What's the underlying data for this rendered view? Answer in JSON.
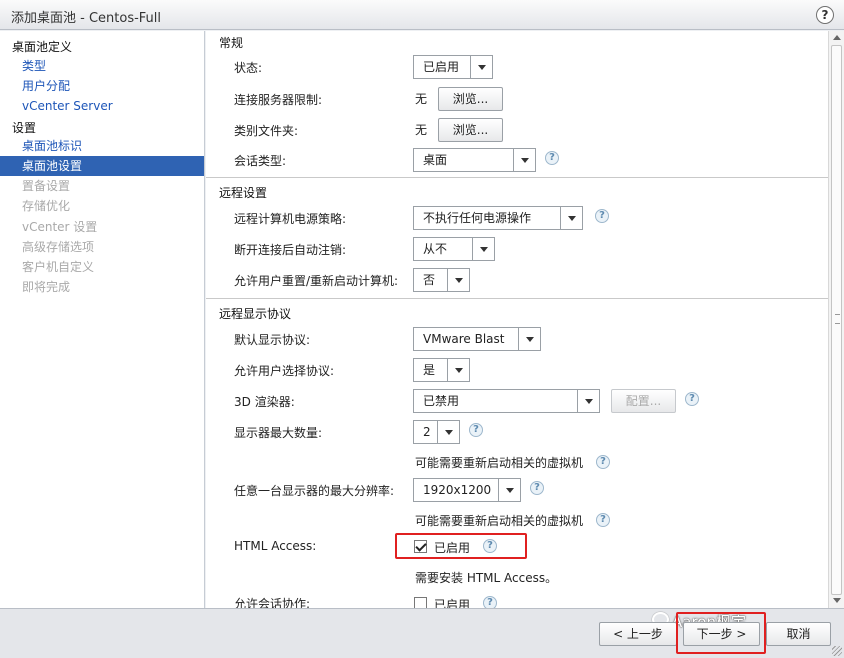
{
  "window": {
    "title": "添加桌面池 - Centos-Full",
    "help_glyph": "?"
  },
  "sidebar": {
    "group1": "桌面池定义",
    "group1_items": [
      "类型",
      "用户分配",
      "vCenter Server"
    ],
    "group2": "设置",
    "group2_items": [
      "桌面池标识",
      "桌面池设置",
      "置备设置",
      "存储优化",
      "vCenter 设置",
      "高级存储选项",
      "客户机自定义",
      "即将完成"
    ],
    "active_item": "桌面池设置"
  },
  "general": {
    "title": "常规",
    "status_label": "状态:",
    "status_value": "已启用",
    "conn_server_label": "连接服务器限制:",
    "conn_server_value": "无",
    "browse_label": "浏览...",
    "category_folder_label": "类别文件夹:",
    "category_folder_value": "无",
    "session_type_label": "会话类型:",
    "session_type_value": "桌面"
  },
  "remote": {
    "title": "远程设置",
    "power_policy_label": "远程计算机电源策略:",
    "power_policy_value": "不执行任何电源操作",
    "auto_logoff_label": "断开连接后自动注销:",
    "auto_logoff_value": "从不",
    "allow_reset_label": "允许用户重置/重新启动计算机:",
    "allow_reset_value": "否"
  },
  "display": {
    "title": "远程显示协议",
    "default_protocol_label": "默认显示协议:",
    "default_protocol_value": "VMware Blast",
    "allow_choose_label": "允许用户选择协议:",
    "allow_choose_value": "是",
    "renderer_label": "3D 渲染器:",
    "renderer_value": "已禁用",
    "configure_label": "配置...",
    "max_monitors_label": "显示器最大数量:",
    "max_monitors_value": "2",
    "restart_note": "可能需要重新启动相关的虚拟机",
    "max_resolution_label": "任意一台显示器的最大分辨率:",
    "max_resolution_value": "1920x1200",
    "html_access_label": "HTML Access:",
    "html_access_checkbox": "已启用",
    "html_access_checked": true,
    "html_access_note": "需要安装 HTML Access。",
    "session_collab_label": "允许会话协作:",
    "session_collab_checkbox": "已启用",
    "session_collab_checked": false
  },
  "footer": {
    "back_label": "< 上一步",
    "next_label": "下一步 >",
    "cancel_label": "取消"
  },
  "watermark": "Aaron枫宇",
  "colors": {
    "accent": "#2f63b3",
    "link": "#1e56b8",
    "highlight": "#e02020"
  }
}
